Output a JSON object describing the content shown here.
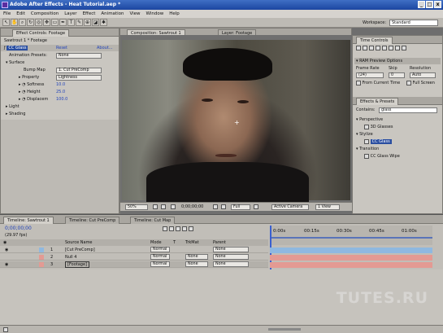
{
  "window": {
    "title": "Adobe After Effects - Heat Tutorial.aep *",
    "min": "_",
    "max": "□",
    "close": "x"
  },
  "menu": [
    "File",
    "Edit",
    "Composition",
    "Layer",
    "Effect",
    "Animation",
    "View",
    "Window",
    "Help"
  ],
  "toolbar": {
    "workspace_label": "Workspace:",
    "workspace_value": "Standard"
  },
  "effect_controls": {
    "tab_label": "Effect Controls: Footage",
    "breadcrumb": "Sawtrout 1 * Footage",
    "effect_name": "CC Glass",
    "reset": "Reset",
    "about": "About...",
    "animation_presets_label": "Animation Presets:",
    "animation_presets_value": "None",
    "surface_label": "Surface",
    "bump_map_label": "Bump Map",
    "bump_map_value": "1. Cut PreComp",
    "property_label": "Property",
    "property_value": "Lightness",
    "softness_label": "Softness",
    "softness_value": "10.0",
    "height_label": "Height",
    "height_value": "25.0",
    "displacement_label": "Displacem",
    "displacement_value": "100.0",
    "light_label": "Light",
    "shading_label": "Shading"
  },
  "composition": {
    "tab_label": "Composition: Sawtrout 1",
    "layer_tab_label": "Layer: Footage",
    "zoom": "50%",
    "timecode": "0;00;00;00",
    "resolution": "Full",
    "camera": "Active Camera",
    "views": "1 View"
  },
  "time_controls": {
    "tab_label": "Time Controls",
    "ram_preview_label": "RAM Preview Options",
    "frame_rate_label": "Frame Rate",
    "skip_label": "Skip",
    "resolution_label": "Resolution",
    "frame_rate_value": "(24)",
    "skip_value": "0",
    "resolution_value": "Auto",
    "from_current_label": "From Current Time",
    "full_screen_label": "Full Screen"
  },
  "effects_presets": {
    "tab_label": "Effects & Presets",
    "contains_label": "Contains:",
    "search_value": "glass",
    "items": [
      {
        "label": "Perspective",
        "level": 0
      },
      {
        "label": "3D Glasses",
        "level": 1
      },
      {
        "label": "Stylize",
        "level": 0
      },
      {
        "label": "CC Glass",
        "level": 1,
        "selected": true
      },
      {
        "label": "Transition",
        "level": 0
      },
      {
        "label": "CC Glass Wipe",
        "level": 1
      }
    ]
  },
  "timeline": {
    "tabs": [
      "Timeline: Sawtrout 1",
      "Timeline: Cut PreComp",
      "Timeline: Cut Map"
    ],
    "current_time": "0;00;00;00",
    "fps": "(29.97 fps)",
    "col_source": "Source Name",
    "col_mode": "Mode",
    "col_t": "T",
    "col_trkmat": "TrkMat",
    "col_parent": "Parent",
    "ruler": [
      "0:00s",
      "00:15s",
      "00:30s",
      "00:45s",
      "01:00s"
    ],
    "layers": [
      {
        "num": "1",
        "name": "[Cut PreComp]",
        "mode": "Normal",
        "trkmat": "",
        "parent": "None",
        "color": "#8fb8e0"
      },
      {
        "num": "2",
        "name": "Null 4",
        "mode": "Normal",
        "trkmat": "None",
        "parent": "None",
        "color": "#e39a93"
      },
      {
        "num": "3",
        "name": "[Footage]",
        "mode": "Normal",
        "trkmat": "None",
        "parent": "None",
        "color": "#e39a93"
      }
    ]
  },
  "watermark": "TUTES.RU"
}
